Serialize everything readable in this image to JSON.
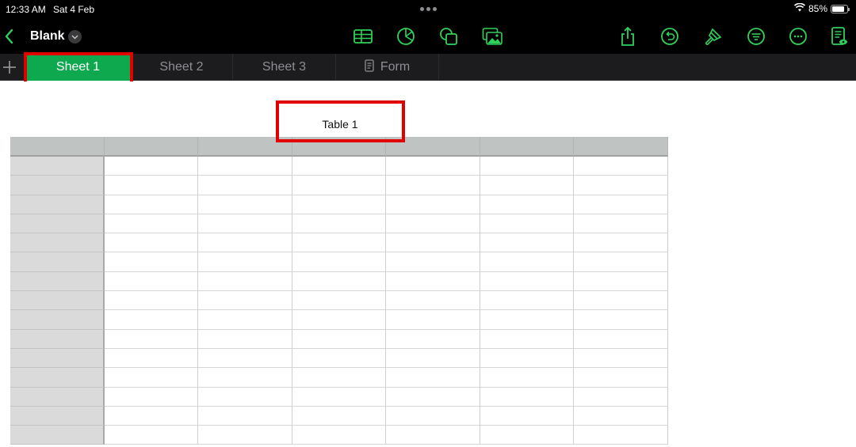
{
  "status_bar": {
    "time": "12:33 AM",
    "date": "Sat 4 Feb",
    "battery_percent": "85%",
    "battery_level": 0.85
  },
  "toolbar": {
    "back_icon": "chevron-left-icon",
    "document_title": "Blank",
    "title_menu_icon": "chevron-down-icon",
    "center_icons": [
      "table-icon",
      "chart-icon",
      "shape-icon",
      "media-icon"
    ],
    "right_icons": [
      "share-icon",
      "undo-icon",
      "format-brush-icon",
      "organize-icon",
      "more-icon",
      "view-mode-icon"
    ],
    "accent_color": "#30d158"
  },
  "tabs": {
    "add_icon": "plus-icon",
    "items": [
      {
        "label": "Sheet 1",
        "active": true
      },
      {
        "label": "Sheet 2",
        "active": false
      },
      {
        "label": "Sheet 3",
        "active": false
      },
      {
        "label": "Form",
        "active": false,
        "icon": "form-icon"
      }
    ],
    "active_color": "#0ea84f"
  },
  "table": {
    "title": "Table 1",
    "columns": 7,
    "rows": 16,
    "header_rows": 1,
    "header_columns": 1,
    "cells": []
  },
  "annotations": {
    "highlight_color": "#e00000",
    "highlighted": [
      "Sheet 1 tab",
      "Table 1 title"
    ]
  }
}
